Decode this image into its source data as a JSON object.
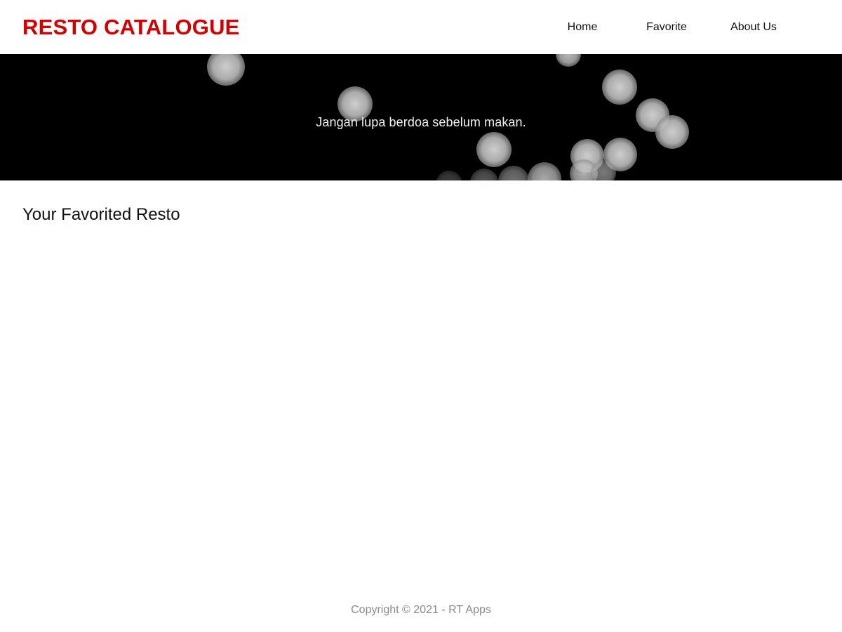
{
  "header": {
    "brand": "RESTO CATALOGUE",
    "brand_color": "#d10000",
    "nav": [
      {
        "label": "Home"
      },
      {
        "label": "Favorite"
      },
      {
        "label": "About Us"
      }
    ]
  },
  "hero": {
    "tagline": "Jangan lupa berdoa sebelum makan.",
    "background": "#000000"
  },
  "main": {
    "section_title": "Your Favorited Resto"
  },
  "footer": {
    "copyright": "Copyright © 2021 - RT Apps"
  }
}
